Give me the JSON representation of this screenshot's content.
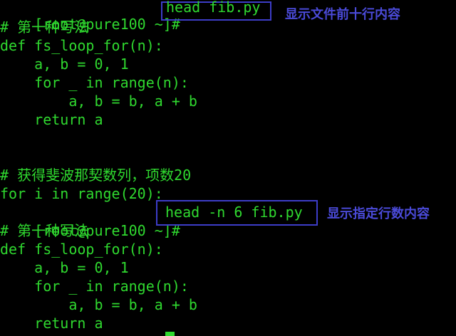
{
  "colors": {
    "background": "#000000",
    "text": "#2fd82f",
    "annotation": "#4a4ad8",
    "box": "#3d3dc8"
  },
  "terminal": {
    "prompt1": "[root@pure100 ~]#",
    "command1": "head fib.py",
    "annotation1": "显示文件前十行内容",
    "output1": [
      "# 第一种写法",
      "def fs_loop_for(n):",
      "    a, b = 0, 1",
      "    for _ in range(n):",
      "        a, b = b, a + b",
      "    return a",
      "",
      "",
      "# 获得斐波那契数列，项数20",
      "for i in range(20):"
    ],
    "prompt2": "[root@pure100 ~]#",
    "command2": "head -n 6 fib.py",
    "annotation2": "显示指定行数内容",
    "output2": [
      "# 第一种写法",
      "def fs_loop_for(n):",
      "    a, b = 0, 1",
      "    for _ in range(n):",
      "        a, b = b, a + b",
      "    return a"
    ]
  }
}
